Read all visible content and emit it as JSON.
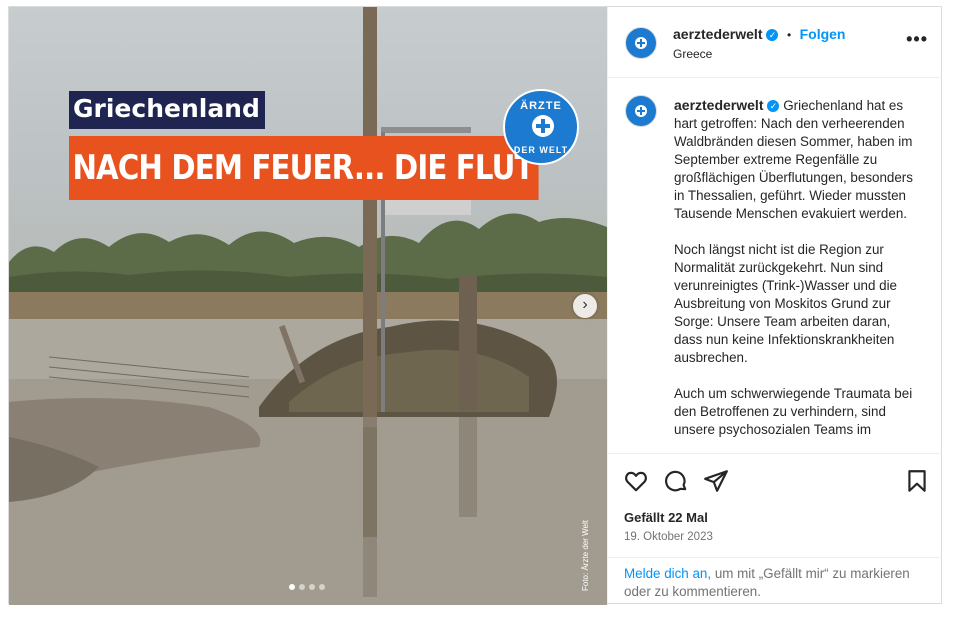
{
  "media": {
    "overlay_tag": "Griechenland",
    "overlay_headline": "NACH DEM FEUER... DIE FLUT",
    "logo_top": "ÄRZTE",
    "logo_bottom": "DER WELT",
    "photo_credit": "Foto: Ärzte der Welt",
    "next_icon": "chevron-right-icon",
    "carousel_count": 4,
    "carousel_active": 1
  },
  "header": {
    "username": "aerztederwelt",
    "separator": "•",
    "follow_label": "Folgen",
    "location": "Greece",
    "more_label": "•••"
  },
  "caption": {
    "username": "aerztederwelt",
    "paragraph1": "Griechenland hat es hart getroffen: Nach den verheerenden Waldbränden diesen Sommer, haben im September extreme Regenfälle zu großflächigen Überflutungen, besonders in Thessalien, geführt. Wieder mussten Tausende Menschen evakuiert werden.",
    "paragraph2": "Noch längst nicht ist die Region zur Normalität zurückgekehrt. Nun sind verunreinigtes (Trink-)Wasser und die Ausbreitung von Moskitos Grund zur Sorge: Unsere Team arbeiten daran, dass nun keine Infektionskrankheiten ausbrechen.",
    "paragraph3": "Auch um schwerwiegende Traumata bei den Betroffenen zu verhindern, sind unsere psychosozialen Teams im"
  },
  "actions": {
    "likes": "Gefällt 22 Mal",
    "date": "19. Oktober 2023"
  },
  "login": {
    "link": "Melde dich an",
    "rest": ", um mit „Gefällt mir“ zu markieren oder zu kommentieren."
  },
  "colors": {
    "brand_blue": "#1c7ad0",
    "headline_orange": "#e8521e",
    "tag_navy": "#1f2550",
    "link_blue": "#0095f6"
  }
}
